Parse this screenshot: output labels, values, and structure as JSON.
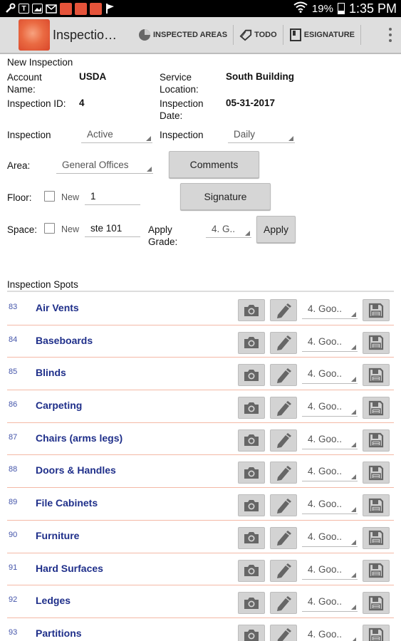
{
  "status_bar": {
    "time": "1:35 PM",
    "battery": "19%",
    "left_icons": [
      "wrench-icon",
      "box-t-icon",
      "image-icon",
      "mail-icon",
      "app-icon",
      "app-icon",
      "app-icon",
      "flag-icon"
    ],
    "right_icons": [
      "wifi-icon",
      "battery-icon"
    ]
  },
  "action_bar": {
    "title": "Inspectio…",
    "inspected_areas": "INSPECTED AREAS",
    "todo": "TODO",
    "esignature": "ESIGNATURE"
  },
  "form": {
    "section_title": "New Inspection",
    "account_name_label": "Account Name:",
    "account_name": "USDA",
    "service_location_label": "Service Location:",
    "service_location": "South Building",
    "inspection_id_label": "Inspection ID:",
    "inspection_id": "4",
    "inspection_date_label": "Inspection Date:",
    "inspection_date": "05-31-2017",
    "inspection_status_label": "Inspection Status:",
    "inspection_status": "Active",
    "inspection_type_label": "Inspection Type:",
    "inspection_type": "Daily",
    "area_label": "Area:",
    "area": "General Offices",
    "comments_button": "Comments",
    "floor_label": "Floor:",
    "floor_new_label": "New",
    "floor_value": "1",
    "signature_button": "Signature",
    "space_label": "Space:",
    "space_new_label": "New",
    "space_value": "ste  101",
    "apply_grade_label": "Apply Grade:",
    "apply_grade_value": "4. G..",
    "apply_button": "Apply"
  },
  "spots": {
    "header": "Inspection Spots",
    "items": [
      {
        "num": "83",
        "name": "Air Vents",
        "grade": "4. Goo.."
      },
      {
        "num": "84",
        "name": "Baseboards",
        "grade": "4. Goo.."
      },
      {
        "num": "85",
        "name": "Blinds",
        "grade": "4. Goo.."
      },
      {
        "num": "86",
        "name": "Carpeting",
        "grade": "4. Goo.."
      },
      {
        "num": "87",
        "name": "Chairs (arms legs)",
        "grade": "4. Goo.."
      },
      {
        "num": "88",
        "name": "Doors & Handles",
        "grade": "4. Goo.."
      },
      {
        "num": "89",
        "name": "File Cabinets",
        "grade": "4. Goo.."
      },
      {
        "num": "90",
        "name": "Furniture",
        "grade": "4. Goo.."
      },
      {
        "num": "91",
        "name": "Hard Surfaces",
        "grade": "4. Goo.."
      },
      {
        "num": "92",
        "name": "Ledges",
        "grade": "4. Goo.."
      },
      {
        "num": "93",
        "name": "Partitions",
        "grade": "4. Goo.."
      }
    ]
  },
  "colors": {
    "accent": "#e5533a",
    "spot_name": "#1f2f8a",
    "row_divider": "#f4b9a6",
    "action_bar": "#dedede"
  }
}
